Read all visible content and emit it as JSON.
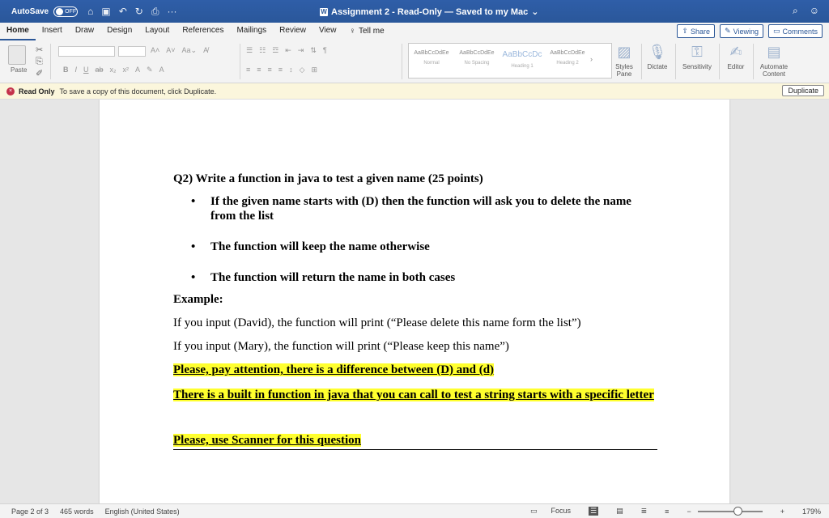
{
  "titlebar": {
    "autosave_label": "AutoSave",
    "autosave_state": "OFF",
    "doc_title": "Assignment 2  -  Read-Only — Saved to my Mac",
    "more": "···"
  },
  "tabs": [
    "Home",
    "Insert",
    "Draw",
    "Design",
    "Layout",
    "References",
    "Mailings",
    "Review",
    "View"
  ],
  "tellme": "Tell me",
  "ribbon_buttons": {
    "share": "Share",
    "viewing": "Viewing",
    "comments": "Comments"
  },
  "ribbon": {
    "paste": "Paste",
    "styles": [
      {
        "sample": "AaBbCcDdEe",
        "name": "Normal"
      },
      {
        "sample": "AaBbCcDdEe",
        "name": "No Spacing"
      },
      {
        "sample": "AaBbCcDc",
        "name": "Heading 1"
      },
      {
        "sample": "AaBbCcDdEe",
        "name": "Heading 2"
      }
    ],
    "styles_pane": "Styles Pane",
    "dictate": "Dictate",
    "sensitivity": "Sensitivity",
    "editor": "Editor",
    "automate": "Automate Content"
  },
  "infobar": {
    "label": "Read Only",
    "message": "To save a copy of this document, click Duplicate.",
    "button": "Duplicate"
  },
  "document": {
    "question": "Q2) Write a function in java to test a given name (25 points)",
    "bullets": [
      "If the given name starts with (D) then the function will ask you to delete the name from the list",
      "The function will keep the name otherwise",
      "The function will return the name in both cases"
    ],
    "example_label": "Example:",
    "example1": "If you input (David), the function will print (“Please delete this name form the list”)",
    "example2": "If you input (Mary), the function will print (“Please keep this name”)",
    "note1": "Please, pay attention, there is a difference between (D) and (d)",
    "note2": "There is a built in function in java that you can call to test a string starts with a specific letter",
    "note3": "Please, use Scanner for this question"
  },
  "status": {
    "page": "Page 2 of 3",
    "words": "465 words",
    "language": "English (United States)",
    "focus": "Focus",
    "zoom": "179%"
  },
  "colors": {
    "accent": "#2b5797",
    "highlight": "#ffff2e"
  }
}
